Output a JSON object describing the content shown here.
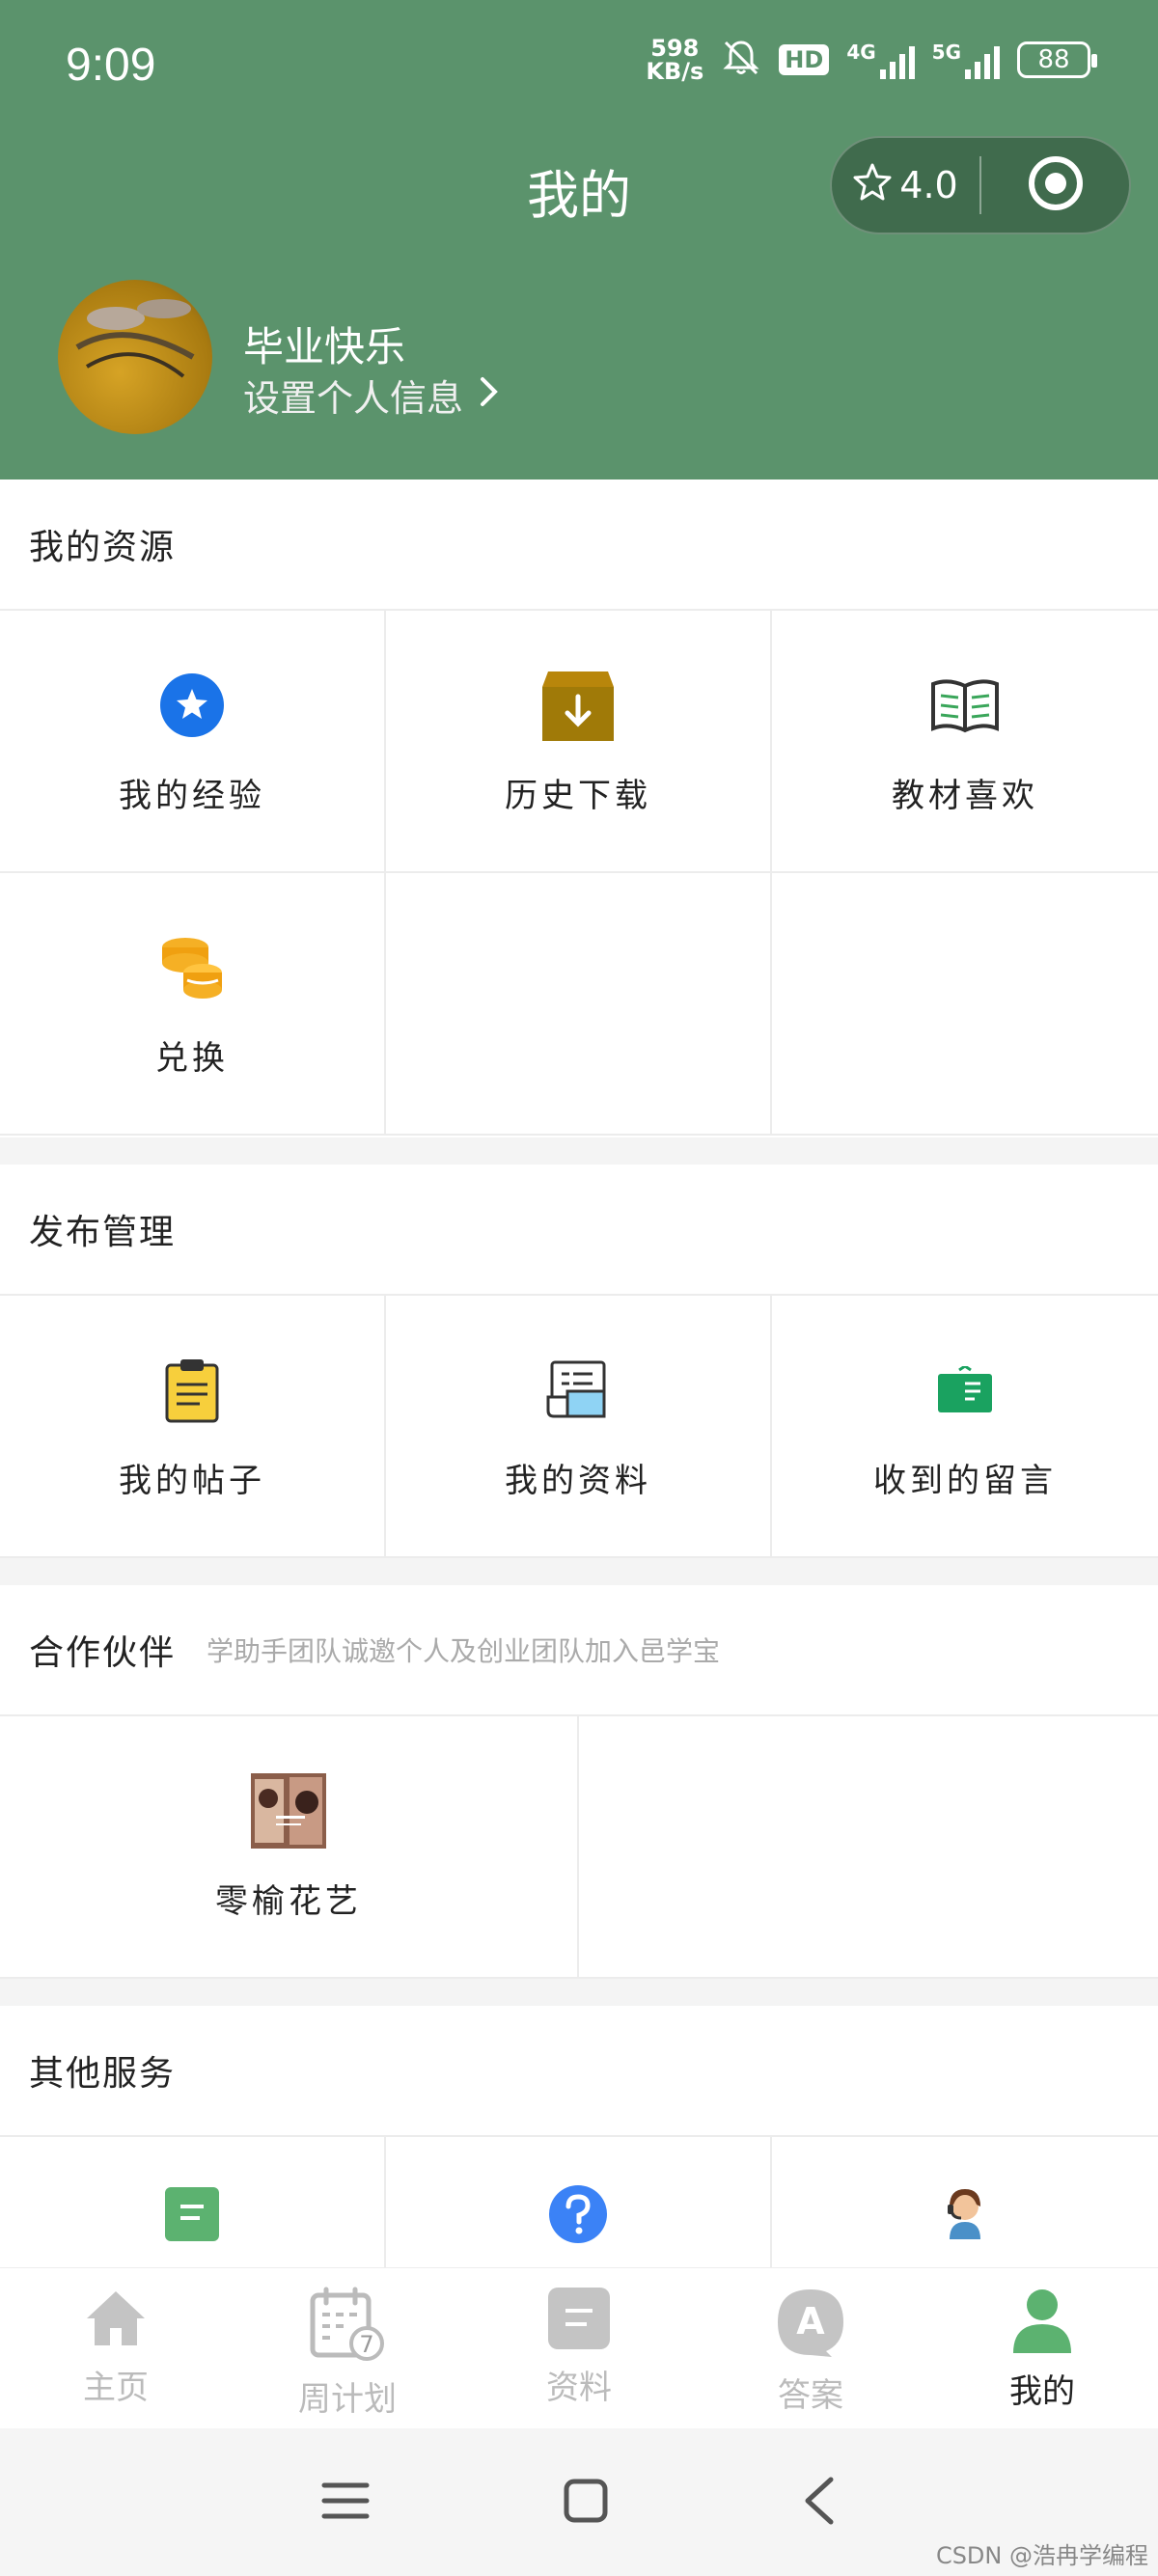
{
  "status_bar": {
    "time": "9:09",
    "net_speed_value": "598",
    "net_speed_unit": "KB/s",
    "hd_badge": "HD",
    "sim1_label": "4G",
    "sim2_label": "5G",
    "battery": "88"
  },
  "header": {
    "title": "我的",
    "rating": "4.0",
    "username": "毕业快乐",
    "profile_link": "设置个人信息"
  },
  "sections": {
    "resources": {
      "title": "我的资源",
      "items": [
        {
          "label": "我的经验",
          "icon": "star-badge-icon"
        },
        {
          "label": "历史下载",
          "icon": "download-box-icon"
        },
        {
          "label": "教材喜欢",
          "icon": "open-book-icon"
        },
        {
          "label": "兑换",
          "icon": "coins-icon"
        }
      ]
    },
    "publish": {
      "title": "发布管理",
      "items": [
        {
          "label": "我的帖子",
          "icon": "clipboard-icon"
        },
        {
          "label": "我的资料",
          "icon": "document-icon"
        },
        {
          "label": "收到的留言",
          "icon": "message-board-icon"
        }
      ]
    },
    "partners": {
      "title": "合作伙伴",
      "subtitle": "学助手团队诚邀个人及创业团队加入邑学宝",
      "items": [
        {
          "label": "零榆花艺",
          "icon": "partner-logo-icon"
        }
      ]
    },
    "others": {
      "title": "其他服务"
    }
  },
  "tabbar": {
    "items": [
      {
        "label": "主页",
        "icon": "home-icon"
      },
      {
        "label": "周计划",
        "icon": "calendar-icon",
        "badge": "7"
      },
      {
        "label": "资料",
        "icon": "file-icon"
      },
      {
        "label": "答案",
        "icon": "answer-icon",
        "glyph": "A"
      },
      {
        "label": "我的",
        "icon": "profile-icon"
      }
    ]
  },
  "watermark": "CSDN @浩冉学编程",
  "colors": {
    "header_bg": "#5b936c",
    "active_tab": "#5cb270",
    "inactive_tab": "#c4c4c4"
  }
}
